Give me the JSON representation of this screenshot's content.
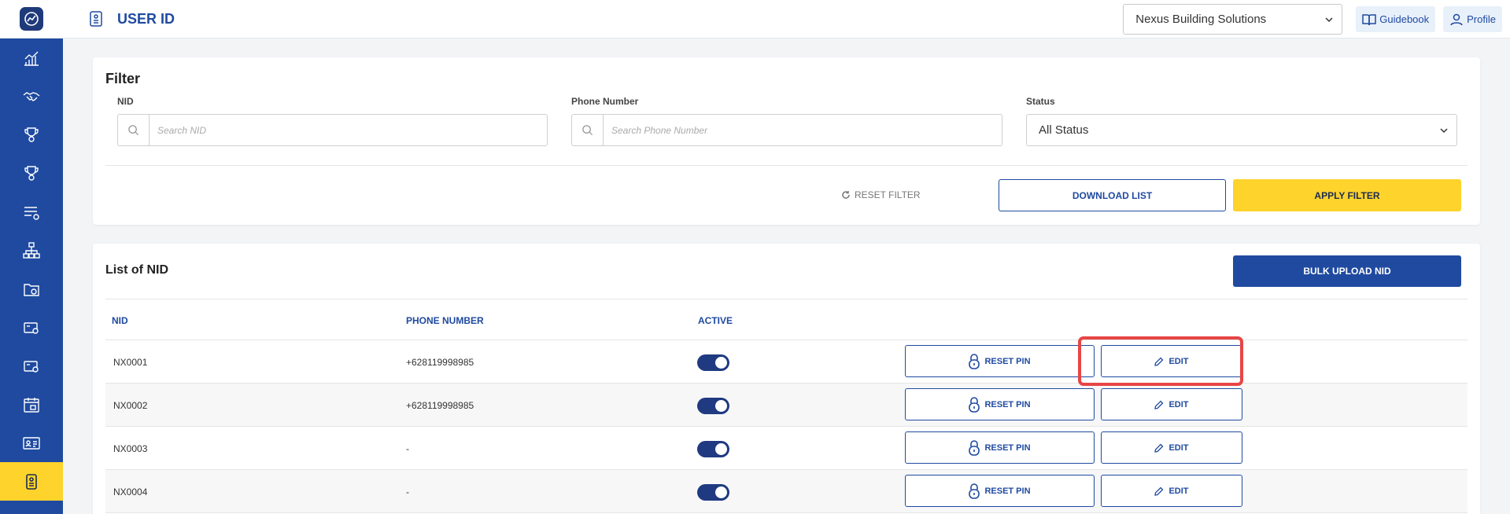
{
  "header": {
    "title": "USER ID",
    "company": "Nexus Building Solutions",
    "guidebook_label": "Guidebook",
    "profile_label": "Profile"
  },
  "filter": {
    "title": "Filter",
    "nid_label": "NID",
    "nid_placeholder": "Search NID",
    "phone_label": "Phone Number",
    "phone_placeholder": "Search Phone Number",
    "status_label": "Status",
    "status_value": "All Status",
    "reset_label": "RESET FILTER",
    "download_label": "DOWNLOAD LIST",
    "apply_label": "APPLY FILTER"
  },
  "list": {
    "title": "List of NID",
    "bulk_upload_label": "BULK UPLOAD NID",
    "columns": [
      "NID",
      "PHONE NUMBER",
      "ACTIVE"
    ],
    "reset_pin_label": "RESET PIN",
    "edit_label": "EDIT",
    "rows": [
      {
        "nid": "NX0001",
        "phone": "+628119998985",
        "active": true
      },
      {
        "nid": "NX0002",
        "phone": "+628119998985",
        "active": true
      },
      {
        "nid": "NX0003",
        "phone": "-",
        "active": true
      },
      {
        "nid": "NX0004",
        "phone": "-",
        "active": true
      }
    ]
  },
  "colors": {
    "primary": "#1f4aa0",
    "accent": "#fdd32c",
    "highlight": "#e84545"
  },
  "sidebar": {
    "icons": [
      "chart-line-icon",
      "handshake-icon",
      "trophy-icon",
      "trophy-icon",
      "list-settings-icon",
      "org-chart-icon",
      "folder-clock-icon",
      "card-settings-icon",
      "card-settings-icon",
      "calendar-icon",
      "id-card-icon",
      "user-id-icon",
      "megaphone-icon"
    ],
    "active_index": 11
  }
}
